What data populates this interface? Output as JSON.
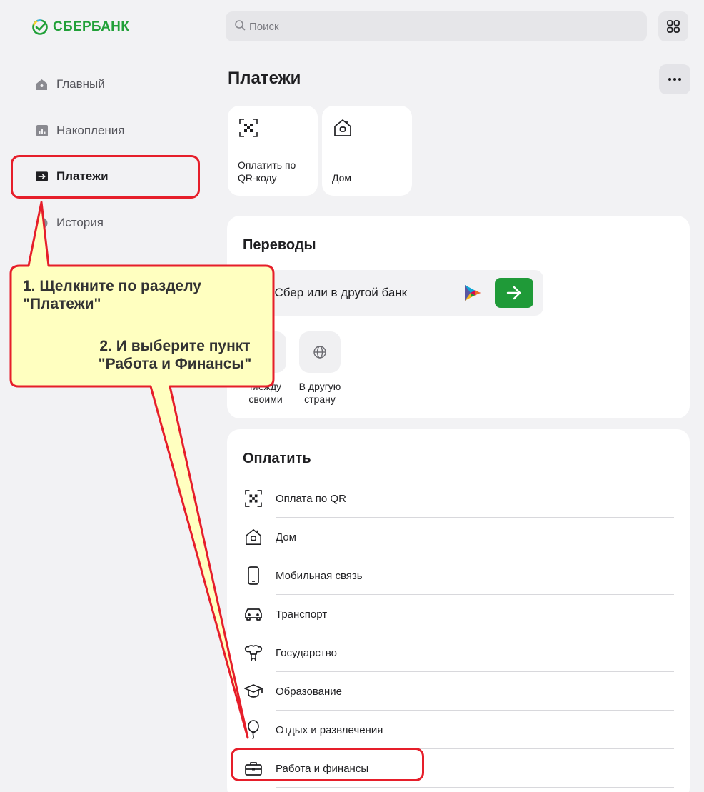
{
  "app": {
    "logo_text": "СБЕРБАНК",
    "brand_color": "#21a038"
  },
  "search": {
    "placeholder": "Поиск",
    "icon": "search-icon"
  },
  "header": {
    "apps_icon": "grid-icon"
  },
  "sidebar": {
    "items": [
      {
        "label": "Главный",
        "icon": "home-icon",
        "active": false
      },
      {
        "label": "Накопления",
        "icon": "chart-icon",
        "active": false
      },
      {
        "label": "Платежи",
        "icon": "payment-arrow-icon",
        "active": true
      },
      {
        "label": "История",
        "icon": "history-icon",
        "active": false
      }
    ]
  },
  "main": {
    "title": "Платежи",
    "more_icon": "more-dots-icon",
    "quick_tiles": [
      {
        "label": "Оплатить по QR-коду",
        "icon": "qr-icon"
      },
      {
        "label": "Дом",
        "icon": "house-icon"
      }
    ],
    "transfers": {
      "title": "Переводы",
      "field_text": "На Сбер или в другой банк",
      "field_text_visible": "Сбер или в другой банк",
      "sbp_icon": "sbp-logo-icon",
      "go_icon": "arrow-right-icon",
      "go_color": "#1f9a38",
      "options": [
        {
          "label": "Между своими",
          "icon": "swap-icon"
        },
        {
          "label": "В другую страну",
          "icon": "globe-icon"
        }
      ]
    },
    "pay": {
      "title": "Оплатить",
      "items": [
        {
          "label": "Оплата по QR",
          "icon": "qr-icon"
        },
        {
          "label": "Дом",
          "icon": "house-icon"
        },
        {
          "label": "Мобильная связь",
          "icon": "phone-icon"
        },
        {
          "label": "Транспорт",
          "icon": "car-icon"
        },
        {
          "label": "Государство",
          "icon": "emblem-icon"
        },
        {
          "label": "Образование",
          "icon": "graduation-cap-icon"
        },
        {
          "label": "Отдых и развлечения",
          "icon": "balloon-icon"
        },
        {
          "label": "Работа и финансы",
          "icon": "briefcase-icon"
        }
      ]
    }
  },
  "annotation": {
    "step1": "1. Щелкните по разделу \"Платежи\"",
    "step2": "2. И выберите пункт \"Работа и Финансы\"",
    "callout_color": "#ffffc0",
    "border_color": "#e61e2a"
  }
}
